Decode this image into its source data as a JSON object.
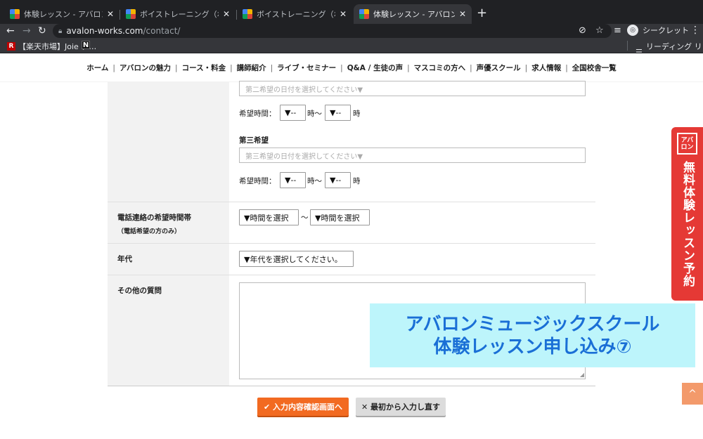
{
  "browser": {
    "tabs": [
      {
        "title": "体験レッスン - アバロン・ミュー"
      },
      {
        "title": "ボイストレーニング（ボイトレ）の"
      },
      {
        "title": "ボイストレーニング（ボイトレ）の"
      },
      {
        "title": "体験レッスン - アバロン・ミュー"
      }
    ],
    "new_tab": "+",
    "url_host": "avalon-works.com",
    "url_path": "/contact/",
    "incognito_label": "シークレット",
    "bookmarks": {
      "rakuten": "【楽天市場】Joie チ…",
      "reading_list": "リーディング リスト"
    }
  },
  "nav": {
    "items": [
      "ホーム",
      "アバロンの魅力",
      "コース・料金",
      "講師紹介",
      "ライブ・セミナー",
      "Q&A / 生徒の声",
      "マスコミの方へ",
      "声優スクール",
      "求人情報",
      "全国校舎一覧"
    ]
  },
  "form": {
    "second_date_placeholder": "第二希望の日付を選択してください▼",
    "hope_time_label": "希望時間：",
    "time_select": "▼--",
    "hour_tilde": "時〜",
    "hour": "時",
    "third_heading": "第三希望",
    "third_date_placeholder": "第三希望の日付を選択してください▼",
    "phone_label": "電話連絡の希望時間帯",
    "phone_sub": "（電話希望の方のみ）",
    "phone_select": "▼時間を選択",
    "tilde": "〜",
    "age_label": "年代",
    "age_select": "▼年代を選択してください。",
    "other_label": "その他の質問"
  },
  "buttons": {
    "confirm": "✔ 入力内容確認画面へ",
    "reset": "✕ 最初から入力し直す"
  },
  "side_tab": {
    "logo": "アバロン",
    "text": "無料体験レッスン予約"
  },
  "overlay": {
    "line1": "アバロンミュージックスクール",
    "line2": "体験レッスン申し込み⑦"
  },
  "scroll_top": "^"
}
